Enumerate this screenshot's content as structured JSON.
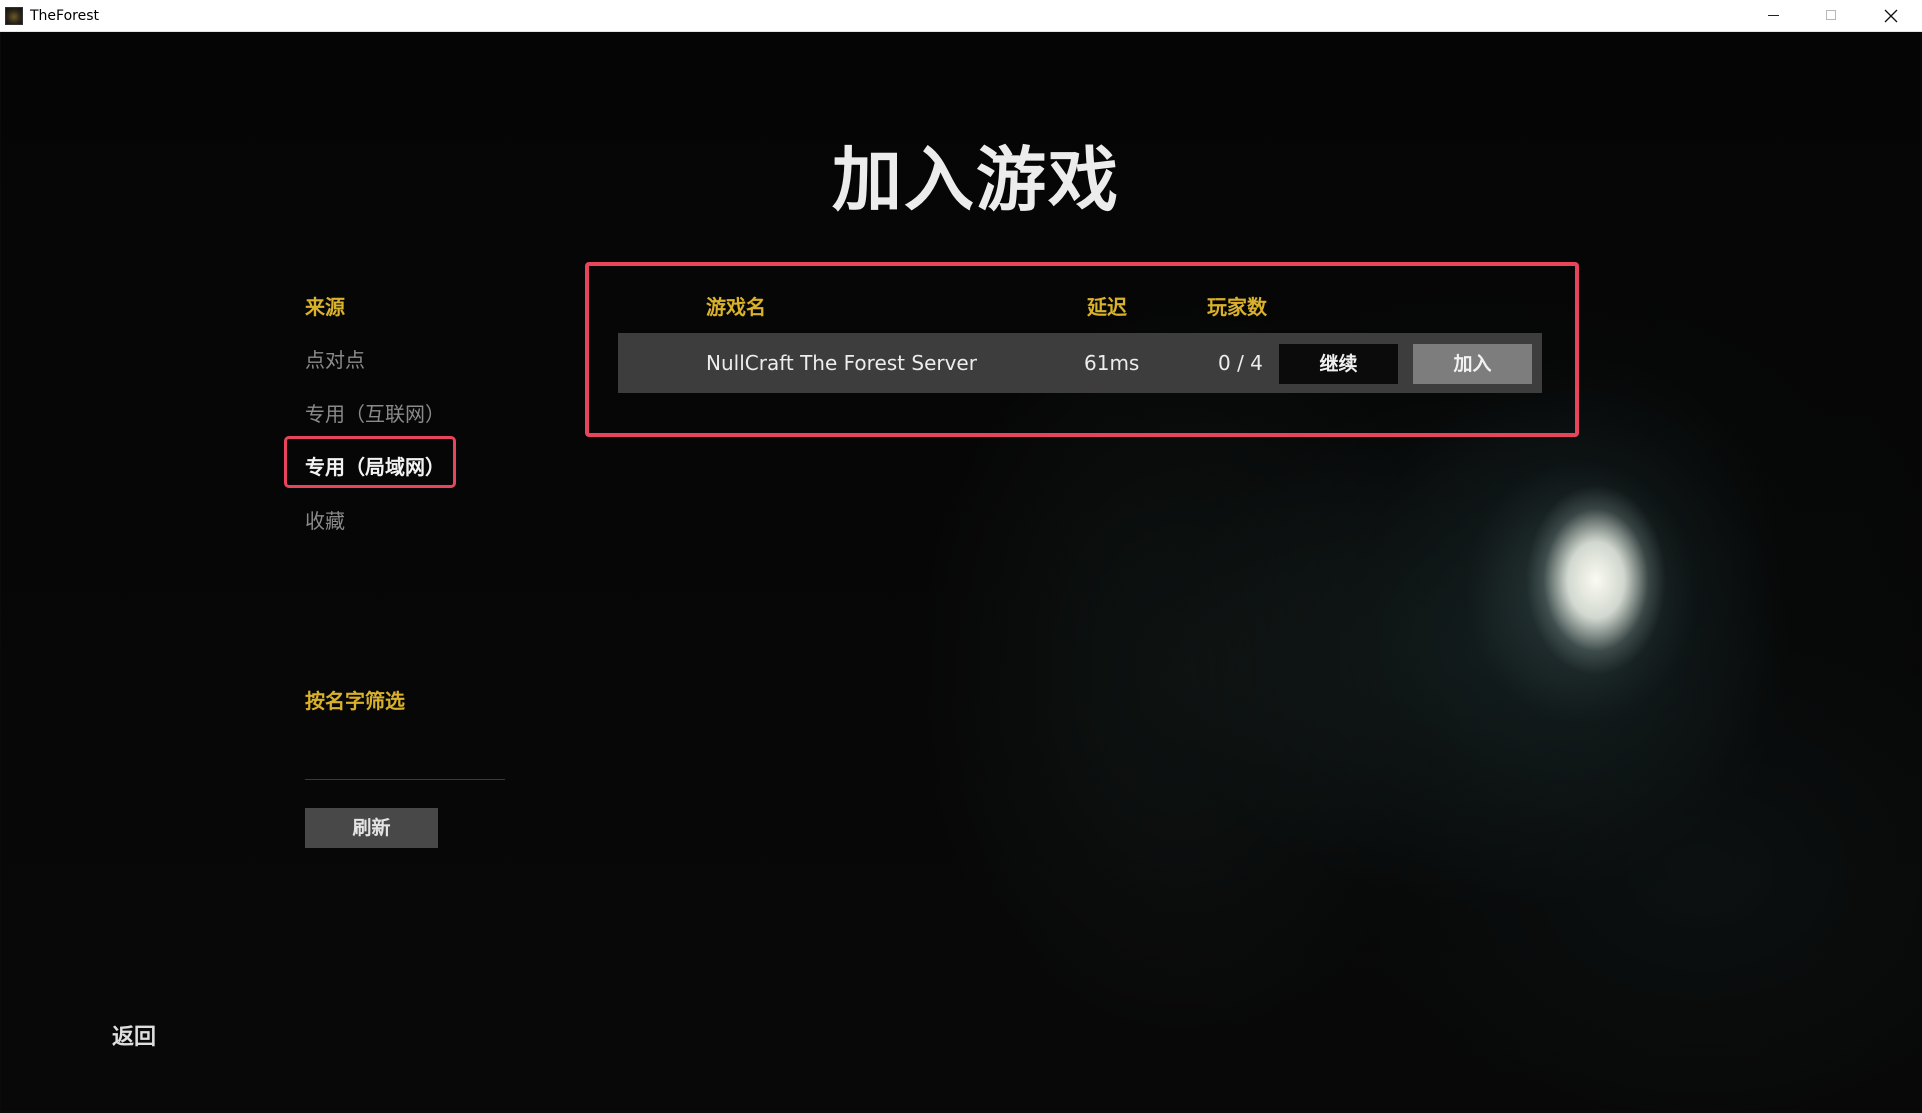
{
  "window": {
    "title": "TheForest",
    "icon": "the-forest-app-icon"
  },
  "page": {
    "title": "加入游戏"
  },
  "sidebar": {
    "source_heading": "来源",
    "items": [
      {
        "label": "点对点",
        "selected": false
      },
      {
        "label": "专用（互联网）",
        "selected": false
      },
      {
        "label": "专用（局域网）",
        "selected": true
      },
      {
        "label": "收藏",
        "selected": false
      }
    ],
    "filter_heading": "按名字筛选",
    "filter_value": "",
    "refresh_label": "刷新",
    "back_label": "返回"
  },
  "server_list": {
    "headers": {
      "name": "游戏名",
      "ping": "延迟",
      "players": "玩家数"
    },
    "rows": [
      {
        "name": "NullCraft The Forest Server",
        "ping": "61ms",
        "players": "0 / 4",
        "continue_label": "继续",
        "join_label": "加入"
      }
    ]
  },
  "colors": {
    "heading_gold": "#d9b12a",
    "highlight_red": "#e8455d",
    "row_bg": "#3d3d3d",
    "join_bg": "#7d7d7d",
    "continue_bg": "#0b0b0b"
  }
}
